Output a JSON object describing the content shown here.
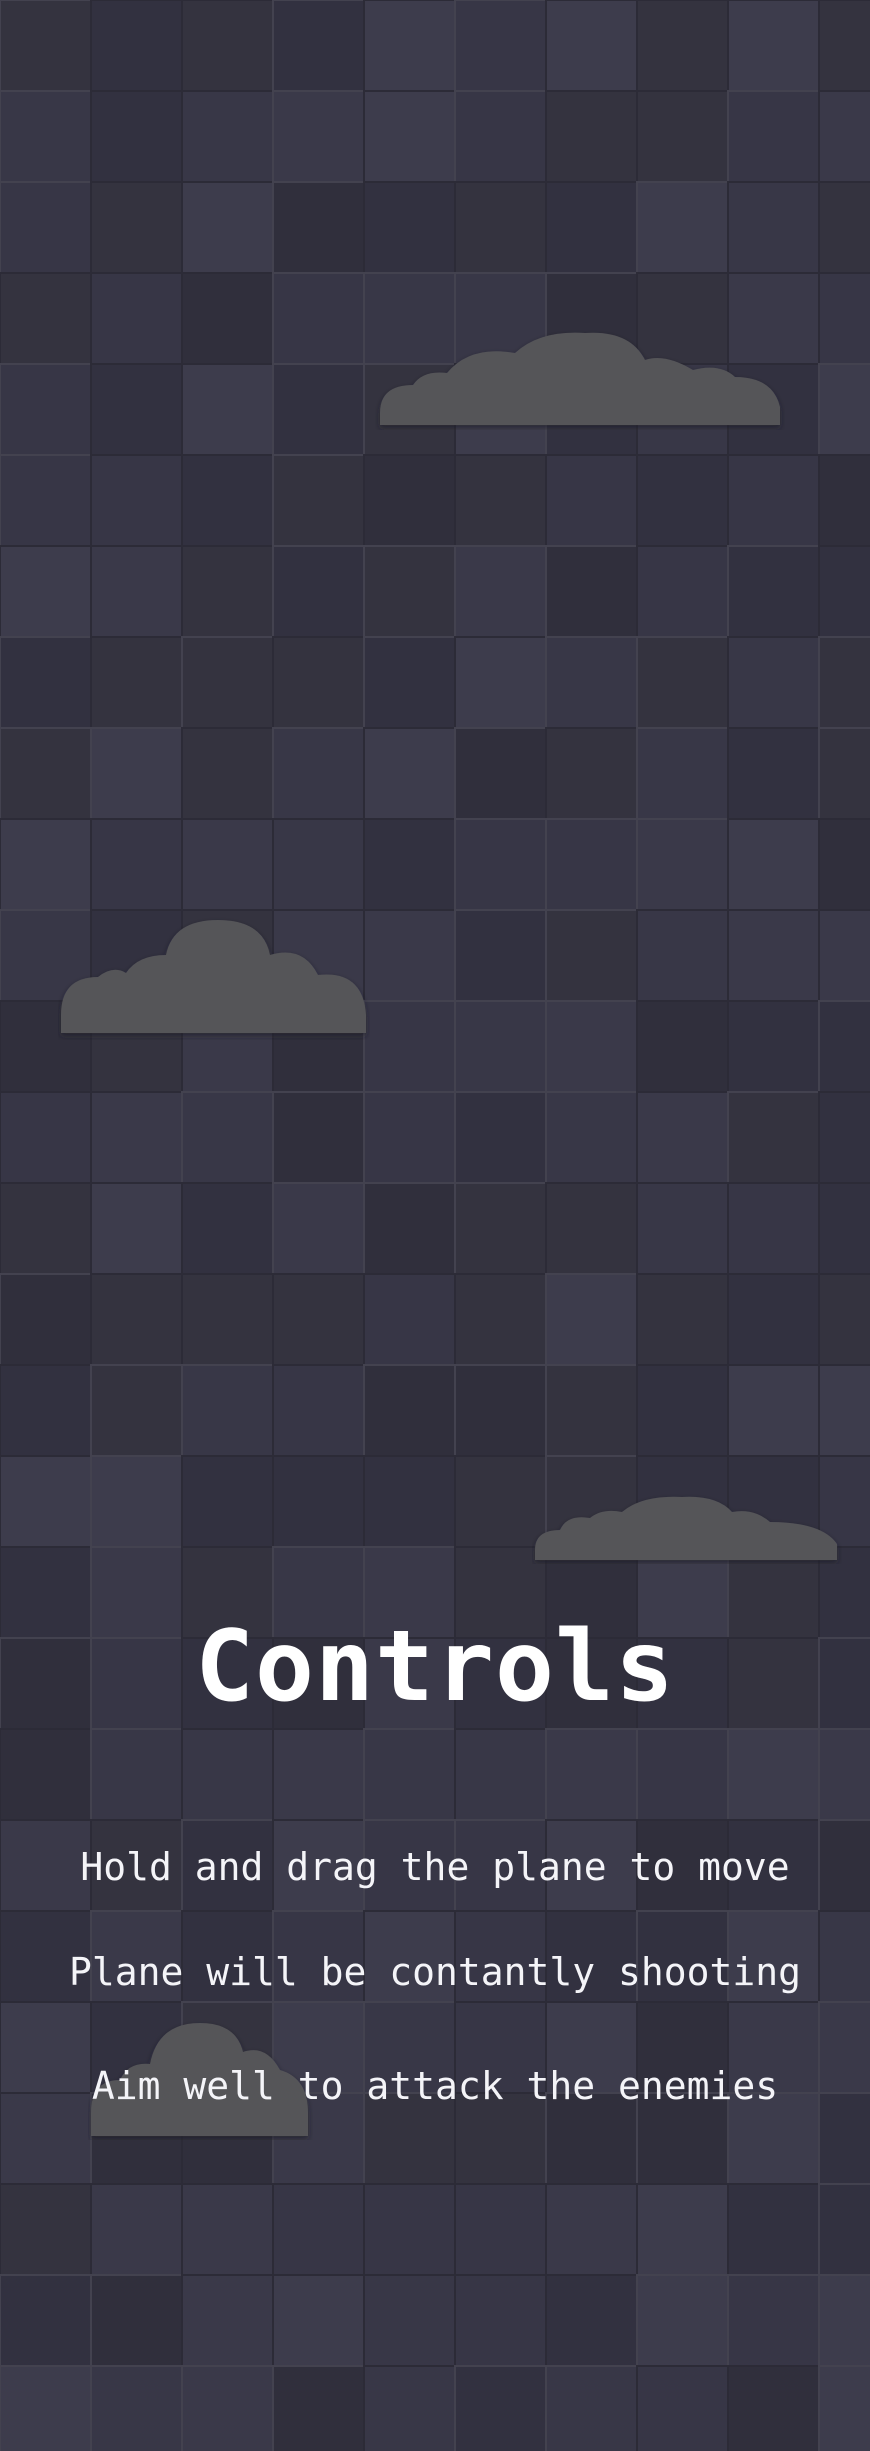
{
  "colors": {
    "background": "#353443",
    "cloud": "#545459",
    "text": "#ffffff"
  },
  "controls": {
    "title": "Controls",
    "instructions": [
      "Hold and drag the plane to move",
      "Plane will be contantly shooting",
      "Aim well to attack the enemies"
    ]
  }
}
